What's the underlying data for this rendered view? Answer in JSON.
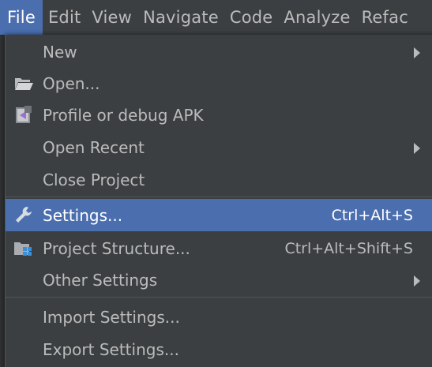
{
  "menubar": {
    "items": [
      {
        "label": "File"
      },
      {
        "label": "Edit"
      },
      {
        "label": "View"
      },
      {
        "label": "Navigate"
      },
      {
        "label": "Code"
      },
      {
        "label": "Analyze"
      },
      {
        "label": "Refac"
      }
    ]
  },
  "file_menu": {
    "items": [
      {
        "label": "New",
        "has_submenu": true
      },
      {
        "label": "Open...",
        "icon": "folder-open-icon"
      },
      {
        "label": "Profile or debug APK",
        "icon": "apk-icon"
      },
      {
        "label": "Open Recent",
        "has_submenu": true
      },
      {
        "label": "Close Project"
      },
      {
        "label": "Settings...",
        "shortcut": "Ctrl+Alt+S",
        "icon": "wrench-icon",
        "selected": true
      },
      {
        "label": "Project Structure...",
        "shortcut": "Ctrl+Alt+Shift+S",
        "icon": "project-structure-icon"
      },
      {
        "label": "Other Settings",
        "has_submenu": true
      },
      {
        "label": "Import Settings..."
      },
      {
        "label": "Export Settings..."
      }
    ]
  },
  "colors": {
    "menu_background": "#3c3f41",
    "selection": "#4b6eaf",
    "text": "#bbbbbb",
    "selected_text": "#ffffff"
  }
}
